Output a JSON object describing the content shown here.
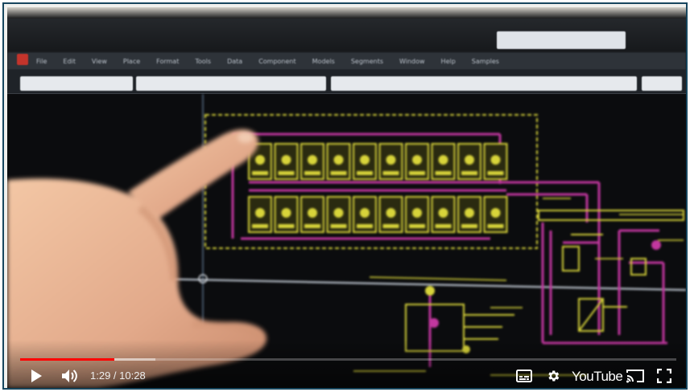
{
  "app": {
    "title": "",
    "menu": [
      "File",
      "Edit",
      "View",
      "Place",
      "Format",
      "Tools",
      "Data",
      "Component",
      "Models",
      "Segments",
      "Window",
      "Help",
      "Samples"
    ],
    "panel_label": "",
    "signin": ""
  },
  "player": {
    "current_time": "1:29",
    "duration": "10:28",
    "time_separator": " / ",
    "progress_fraction": 0.144,
    "buffered_fraction": 0.206,
    "logo_text": "YouTube",
    "accent_color": "#ff0000"
  },
  "icons": {
    "play": "play-icon",
    "volume": "volume-icon",
    "captions": "captions-icon",
    "settings": "gear-icon",
    "cast": "cast-icon",
    "fullscreen": "fullscreen-icon"
  },
  "schematic": {
    "wire_color": "#c2379f",
    "component_color": "#d8d43a",
    "led_rows": 2,
    "led_columns": 10
  }
}
